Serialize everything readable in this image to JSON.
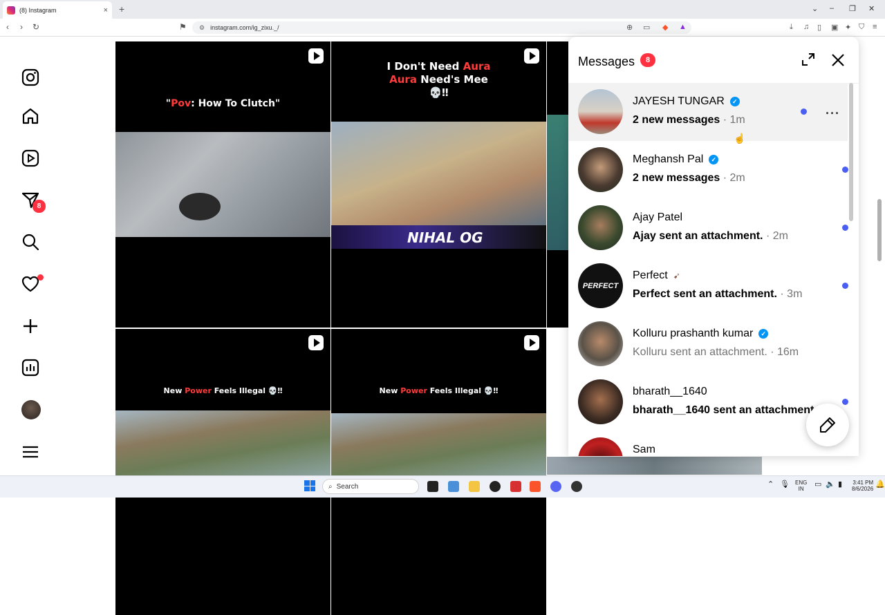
{
  "browser": {
    "tab_title": "(8) Instagram",
    "tab_close": "×",
    "new_tab": "+",
    "url": "instagram.com/ig_zixu._/",
    "win_min": "–",
    "win_max": "❐",
    "win_close": "✕",
    "win_chev": "⌄"
  },
  "rail": {
    "notification_badge": "8"
  },
  "tiles": {
    "t1_text_a": "\"",
    "t1_text_red": "Pov",
    "t1_text_b": ": How To Clutch\"",
    "t2_line1_a": "I Don't Need ",
    "t2_line1_red": "Aura",
    "t2_line2_red": "Aura",
    "t2_line2_b": " Need's Mee",
    "t2_line3": "💀‼",
    "t2_banner": "NIHAL OG",
    "t4_a": "New ",
    "t4_red": "Power",
    "t4_b": " Feels Illegal 💀‼",
    "t5_a": "New ",
    "t5_red": "Power",
    "t5_b": " Feels Illegal 💀‼"
  },
  "messages": {
    "title": "Messages",
    "count": "8",
    "more": "···",
    "rows": [
      {
        "name": "JAYESH TUNGAR",
        "preview": "2 new messages",
        "time": "· 1m",
        "verified": true
      },
      {
        "name": "Meghansh Pal",
        "preview": "2 new messages",
        "time": "· 2m",
        "verified": true
      },
      {
        "name": "Ajay Patel",
        "preview": "Ajay sent an attachment.",
        "time": "· 2m",
        "verified": false
      },
      {
        "name": "Perfect",
        "preview": "Perfect sent an attachment.",
        "time": "· 3m",
        "verified": false
      },
      {
        "name": "Kolluru prashanth kumar",
        "preview": "Kolluru sent an attachment.",
        "time": "· 16m",
        "verified": true
      },
      {
        "name": "bharath__1640",
        "preview": "bharath__1640 sent an attachment",
        "time": "",
        "verified": false
      },
      {
        "name": "Sam",
        "preview": "",
        "time": "",
        "verified": false
      }
    ],
    "perfect_logo": "PERFECT"
  },
  "taskbar": {
    "search_label": "Search",
    "lang_top": "ENG",
    "lang_bottom": "IN",
    "time": "3:41 PM",
    "date": "8/6/2026"
  },
  "colors": {
    "accent_red": "#ff3040",
    "unread_dot": "#4a5ef2",
    "verified_blue": "#0095f6"
  }
}
